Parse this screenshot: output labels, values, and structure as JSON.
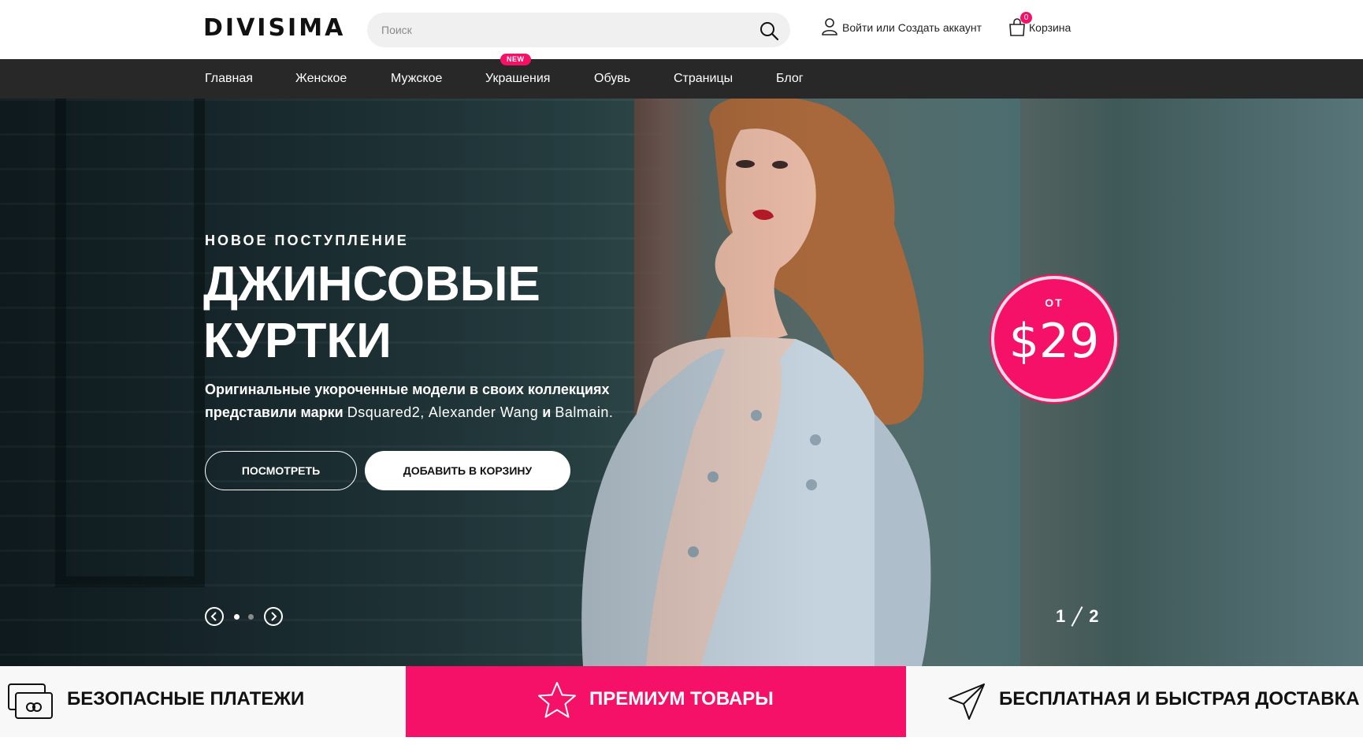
{
  "brand": {
    "logo_text": "DIVISIMA",
    "accent_color": "#f51167"
  },
  "header": {
    "search_placeholder": "Поиск",
    "search_icon": "search-icon",
    "account_label": "Войти или Создать аккаунт",
    "account_icon": "user-icon",
    "cart_label": "Корзина",
    "cart_count": "0",
    "cart_icon": "shopping-bag-icon"
  },
  "nav": {
    "items": [
      {
        "label": "Главная"
      },
      {
        "label": "Женское"
      },
      {
        "label": "Мужское"
      },
      {
        "label": "Украшения",
        "badge": "NEW"
      },
      {
        "label": "Обувь"
      },
      {
        "label": "Страницы"
      },
      {
        "label": "Блог"
      }
    ]
  },
  "hero": {
    "kicker": "НОВОЕ ПОСТУПЛЕНИЕ",
    "title": "ДЖИНСОВЫЕ КУРТКИ",
    "desc_part1": "Оригинальные укороченные модели в своих коллекциях представили марки",
    "brand1": "Dsquared2",
    "desc_sep": ",",
    "brand2": "Alexander Wang",
    "desc_and": "и",
    "brand3": "Balmain",
    "desc_end": ".",
    "btn_view": "ПОСМОТРЕТЬ",
    "btn_cart": "ДОБАВИТЬ В КОРЗИНУ",
    "price_from": "ОТ",
    "price": "$29",
    "slide_current": "1",
    "slide_total": "2",
    "dots_active_index": 0
  },
  "features": [
    {
      "label": "БЕЗОПАСНЫЕ ПЛАТЕЖИ",
      "icon": "credit-card-icon"
    },
    {
      "label": "ПРЕМИУМ ТОВАРЫ",
      "icon": "star-icon"
    },
    {
      "label": "БЕСПЛАТНАЯ И БЫСТРАЯ ДОСТАВКА",
      "icon": "paper-plane-icon"
    }
  ]
}
